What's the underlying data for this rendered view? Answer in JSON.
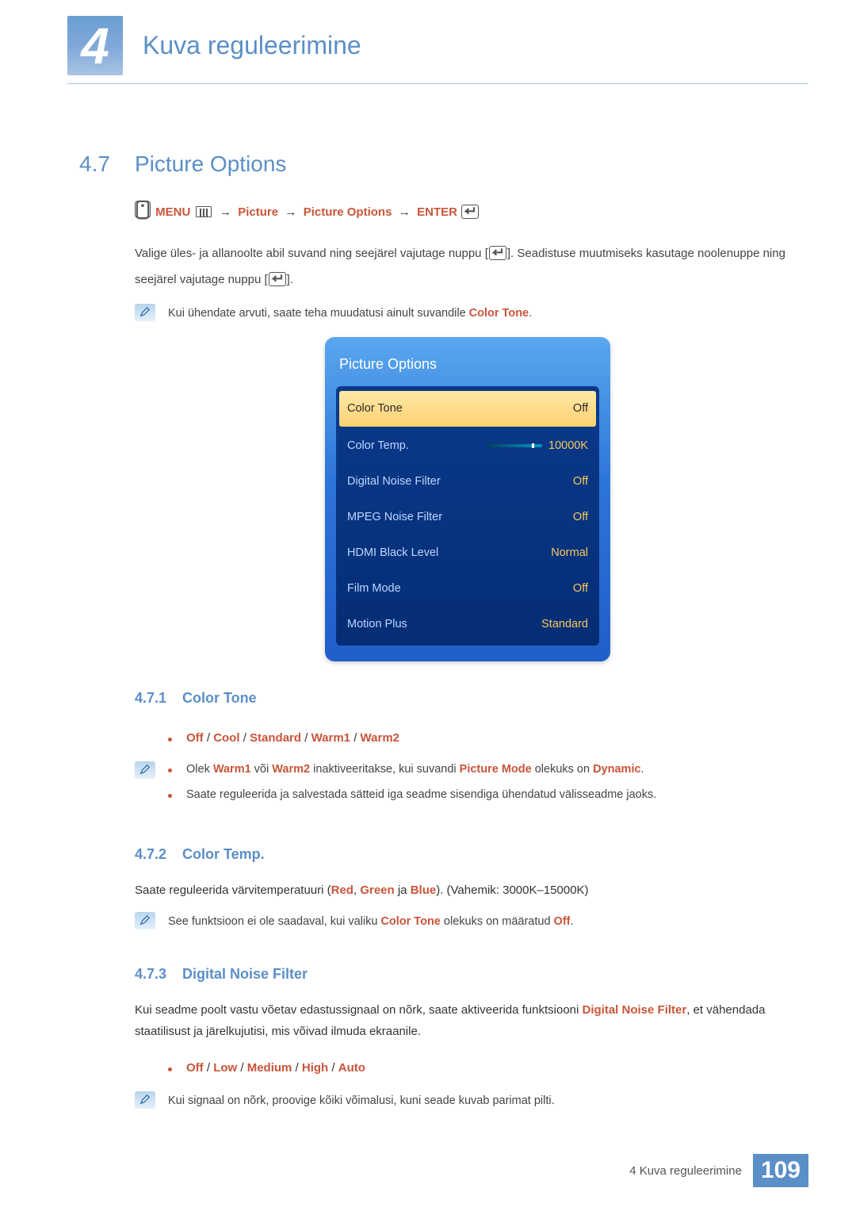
{
  "chapter": {
    "number": "4",
    "title": "Kuva reguleerimine"
  },
  "section": {
    "number": "4.7",
    "title": "Picture Options",
    "nav": {
      "menu": "MENU",
      "arrow": "→",
      "p1": "Picture",
      "p2": "Picture Options",
      "enter": "ENTER"
    },
    "body1a": "Valige üles- ja allanoolte abil suvand ning seejärel vajutage nuppu [",
    "body1b": "]. Seadistuse muutmiseks kasutage noolenuppe ning seejärel vajutage nuppu [",
    "body1c": "].",
    "note1_pre": "Kui ühendate arvuti, saate teha muudatusi ainult suvandile ",
    "note1_hl": "Color Tone",
    "note1_post": "."
  },
  "osd": {
    "title": "Picture Options",
    "items": [
      {
        "label": "Color Tone",
        "value": "Off",
        "selected": true
      },
      {
        "label": "Color Temp.",
        "value": "10000K",
        "slider": true
      },
      {
        "label": "Digital Noise Filter",
        "value": "Off"
      },
      {
        "label": "MPEG Noise Filter",
        "value": "Off"
      },
      {
        "label": "HDMI Black Level",
        "value": "Normal"
      },
      {
        "label": "Film Mode",
        "value": "Off"
      },
      {
        "label": "Motion Plus",
        "value": "Standard"
      }
    ]
  },
  "sub1": {
    "num": "4.7.1",
    "title": "Color Tone",
    "options": [
      "Off",
      "Cool",
      "Standard",
      "Warm1",
      "Warm2"
    ],
    "note_b1_pre": "Olek ",
    "note_b1_w1": "Warm1",
    "note_b1_mid1": " või ",
    "note_b1_w2": "Warm2",
    "note_b1_mid2": " inaktiveeritakse, kui suvandi ",
    "note_b1_pm": "Picture Mode",
    "note_b1_mid3": " olekuks on ",
    "note_b1_dy": "Dynamic",
    "note_b1_post": ".",
    "note_b2": "Saate reguleerida ja salvestada sätteid iga seadme sisendiga ühendatud välisseadme jaoks."
  },
  "sub2": {
    "num": "4.7.2",
    "title": "Color Temp.",
    "body_pre": "Saate reguleerida värvitemperatuuri (",
    "r": "Red",
    "g": "Green",
    "b": "Blue",
    "body_mid": ", ",
    "body_and": " ja ",
    "body_post": "). (Vahemik: 3000K–15000K)",
    "note_pre": "See funktsioon ei ole saadaval, kui valiku ",
    "note_ct": "Color Tone",
    "note_mid": " olekuks on määratud ",
    "note_off": "Off",
    "note_post": "."
  },
  "sub3": {
    "num": "4.7.3",
    "title": "Digital Noise Filter",
    "body_pre": "Kui seadme poolt vastu võetav edastussignaal on nõrk, saate aktiveerida funktsiooni ",
    "body_hl": "Digital Noise Filter",
    "body_post": ", et vähendada staatilisust ja järelkujutisi, mis võivad ilmuda ekraanile.",
    "options": [
      "Off",
      "Low",
      "Medium",
      "High",
      "Auto"
    ],
    "note": "Kui signaal on nõrk, proovige kõiki võimalusi, kuni seade kuvab parimat pilti."
  },
  "footer": {
    "text": "4 Kuva reguleerimine",
    "page": "109"
  }
}
